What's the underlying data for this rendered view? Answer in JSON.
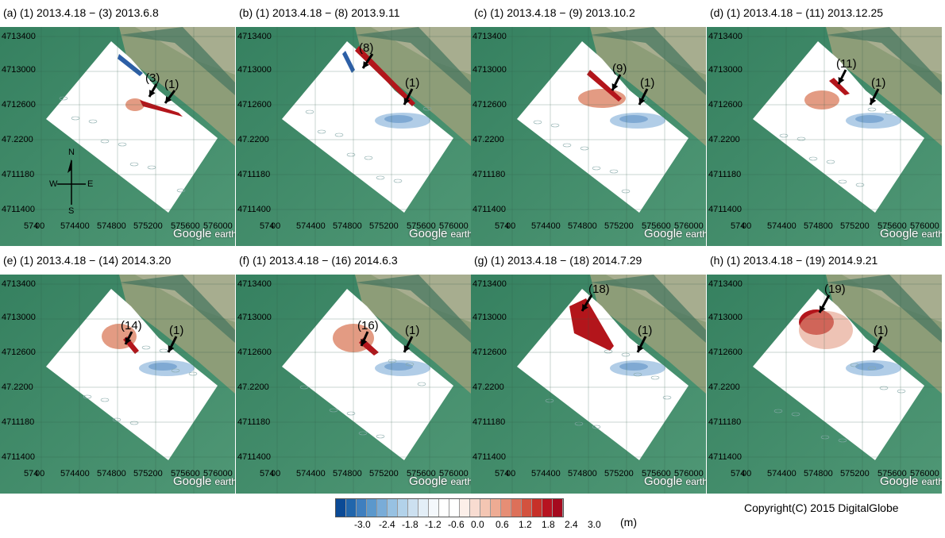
{
  "panels": [
    {
      "title": "(a) (1) 2013.4.18 − (3) 2013.6.8",
      "labels": [
        "(3)",
        "(1)"
      ]
    },
    {
      "title": "(b) (1) 2013.4.18 − (8) 2013.9.11",
      "labels": [
        "(8)",
        "(1)"
      ]
    },
    {
      "title": "(c) (1) 2013.4.18 − (9) 2013.10.2",
      "labels": [
        "(9)",
        "(1)"
      ]
    },
    {
      "title": "(d) (1) 2013.4.18 − (11) 2013.12.25",
      "labels": [
        "(11)",
        "(1)"
      ]
    },
    {
      "title": "(e) (1) 2013.4.18 − (14) 2014.3.20",
      "labels": [
        "(14)",
        "(1)"
      ]
    },
    {
      "title": "(f) (1) 2013.4.18 − (16) 2014.6.3",
      "labels": [
        "(16)",
        "(1)"
      ]
    },
    {
      "title": "(g) (1) 2013.4.18 − (18) 2014.7.29",
      "labels": [
        "(18)",
        "(1)"
      ]
    },
    {
      "title": "(h) (1) 2013.4.18 − (19) 2014.9.21",
      "labels": [
        "(19)",
        "(1)"
      ]
    }
  ],
  "y_ticks": [
    "4713400",
    "4713000",
    "4712600",
    "47.2200",
    "4711180",
    "4711400"
  ],
  "x_ticks": [
    "574",
    "00",
    "574400",
    "574800",
    "575200",
    "575600",
    "576000"
  ],
  "compass": {
    "n": "N",
    "s": "S",
    "e": "E",
    "w": "W"
  },
  "watermark": {
    "google": "Google",
    "earth": "earth"
  },
  "colorbar": {
    "ticks": [
      "-3.0",
      "-2.4",
      "-1.8",
      "-1.2",
      "-0.6",
      "0.0",
      "0.6",
      "1.2",
      "1.8",
      "2.4",
      "3.0"
    ],
    "unit": "(m)",
    "colors": [
      "#0b4a96",
      "#2166ac",
      "#3f7fbf",
      "#5b98cc",
      "#79acd8",
      "#97c1e2",
      "#b2d2ea",
      "#cce0f0",
      "#e3eef7",
      "#f4f8fc",
      "#ffffff",
      "#ffffff",
      "#fcefe9",
      "#f8dcd1",
      "#f4c6b3",
      "#eeab93",
      "#e68e75",
      "#dd7059",
      "#d3523f",
      "#c73028",
      "#b71320",
      "#a50a1e"
    ]
  },
  "copyright": "Copyright(C) 2015 DigitalGlobe"
}
